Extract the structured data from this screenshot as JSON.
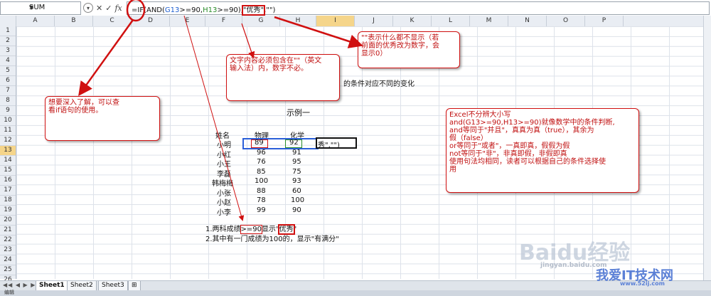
{
  "name_box": "SUM",
  "formula_bar": {
    "prefix": "=IF(AND(",
    "ref1": "G13",
    "op1": ">=90,",
    "ref2": "H13",
    "op2": ">=90),",
    "result": "\"优秀\"",
    "tail": ",\"\")"
  },
  "columns": [
    "A",
    "B",
    "C",
    "D",
    "E",
    "F",
    "G",
    "H",
    "I",
    "J",
    "K",
    "L",
    "M",
    "N",
    "O",
    "P"
  ],
  "rows": [
    "1",
    "2",
    "3",
    "4",
    "5",
    "6",
    "7",
    "8",
    "9",
    "10",
    "11",
    "12",
    "13",
    "14",
    "15",
    "16",
    "17",
    "18",
    "19",
    "20",
    "21",
    "22",
    "23",
    "24",
    "25",
    "26"
  ],
  "sheet": {
    "title_partial": "的条件对应不同的变化",
    "example_title": "示例一",
    "headers": [
      "姓名",
      "物理",
      "化学"
    ],
    "table": [
      [
        "小明",
        "89",
        "92"
      ],
      [
        "小红",
        "96",
        "91"
      ],
      [
        "小王",
        "76",
        "95"
      ],
      [
        "李磊",
        "85",
        "75"
      ],
      [
        "韩梅梅",
        "100",
        "93"
      ],
      [
        "小张",
        "88",
        "60"
      ],
      [
        "小赵",
        "78",
        "100"
      ],
      [
        "小李",
        "99",
        "90"
      ]
    ],
    "active_cell_text": "秀\",\"\")",
    "note1_prefix": "1.两科成绩",
    "note1_mid": ">=90",
    "note1_after": "显示\"",
    "note1_box": "优秀",
    "note1_end": "\"",
    "note2": "2.其中有一门成绩为100的，显示\"有满分\""
  },
  "callouts": {
    "blank_value": [
      "\"\"表示什么都不显示（若",
      "前面的优秀改为数字，会",
      "显示0）"
    ],
    "text_quotes": [
      "文字内容必须包含在\"\"（英文",
      "输入法）内，数字不必。"
    ],
    "learn_if": [
      "想要深入了解，可以查",
      "看if语句的使用。"
    ],
    "explain": [
      "Excel不分辨大小写",
      "and(G13>=90,H13>=90)就像数学中的条件判断,",
      "and等同于\"并且\"，真真为真（true），其余为",
      "假（false）",
      "or等同于\"或者\"，一真即真，假假为假",
      "not等同于\"非\"，非真即假，非假即真",
      "使用句法均相同，读者可以根据自己的条件选择使",
      "用"
    ]
  },
  "sheet_tabs": [
    "Sheet1",
    "Sheet2",
    "Sheet3"
  ],
  "status": "编辑",
  "watermarks": {
    "baidu": "Baidu经验",
    "site": "我爱IT技术网",
    "url": "jingyan.baidu.com",
    "url2": "www.52ij.com"
  },
  "colors": {
    "annotation_red": "#d01010",
    "ref_blue": "#1f5fd1",
    "ref_green": "#2a8c2a",
    "header_highlight": "#f5d58a"
  }
}
